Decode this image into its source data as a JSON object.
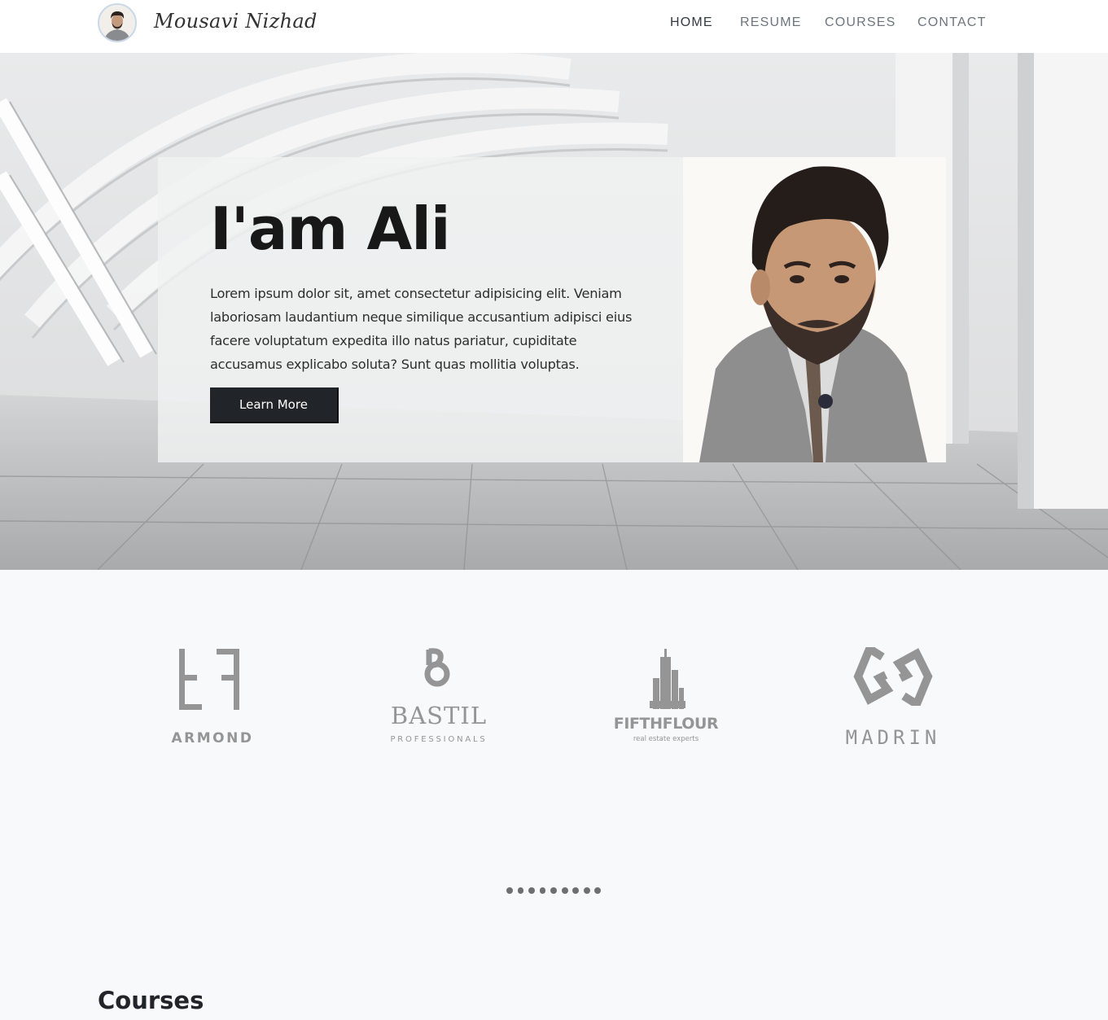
{
  "header": {
    "brand_name": "Mousavi Nizhad",
    "avatar_icon": "profile-avatar",
    "nav": {
      "home": "HOME",
      "resume": "RESUME",
      "courses": "COURSES",
      "contact": "CONTACT",
      "active": "HOME"
    }
  },
  "hero": {
    "title": "I'am Ali",
    "text": "Lorem ipsum dolor sit, amet consectetur adipisicing elit. Veniam laboriosam laudantium neque similique accusantium adipisci eius facere voluptatum expedita illo natus pariatur, cupiditate accusamus explicabo soluta? Sunt quas mollitia voluptas.",
    "button_label": "Learn More",
    "portrait_icon": "person-portrait"
  },
  "partners": {
    "items": [
      {
        "name": "ARMOND",
        "tagline": ""
      },
      {
        "name": "BASTIL",
        "tagline": "PROFESSIONALS"
      },
      {
        "name": "FIFTHFLOUR",
        "tagline": "real estate experts"
      },
      {
        "name": "MADRIN",
        "tagline": ""
      }
    ],
    "slide_count": 9
  },
  "courses": {
    "title": "Courses"
  },
  "colors": {
    "primary_dark": "#212529",
    "logo_gray": "#959595",
    "page_bg": "#f8f9fa"
  }
}
